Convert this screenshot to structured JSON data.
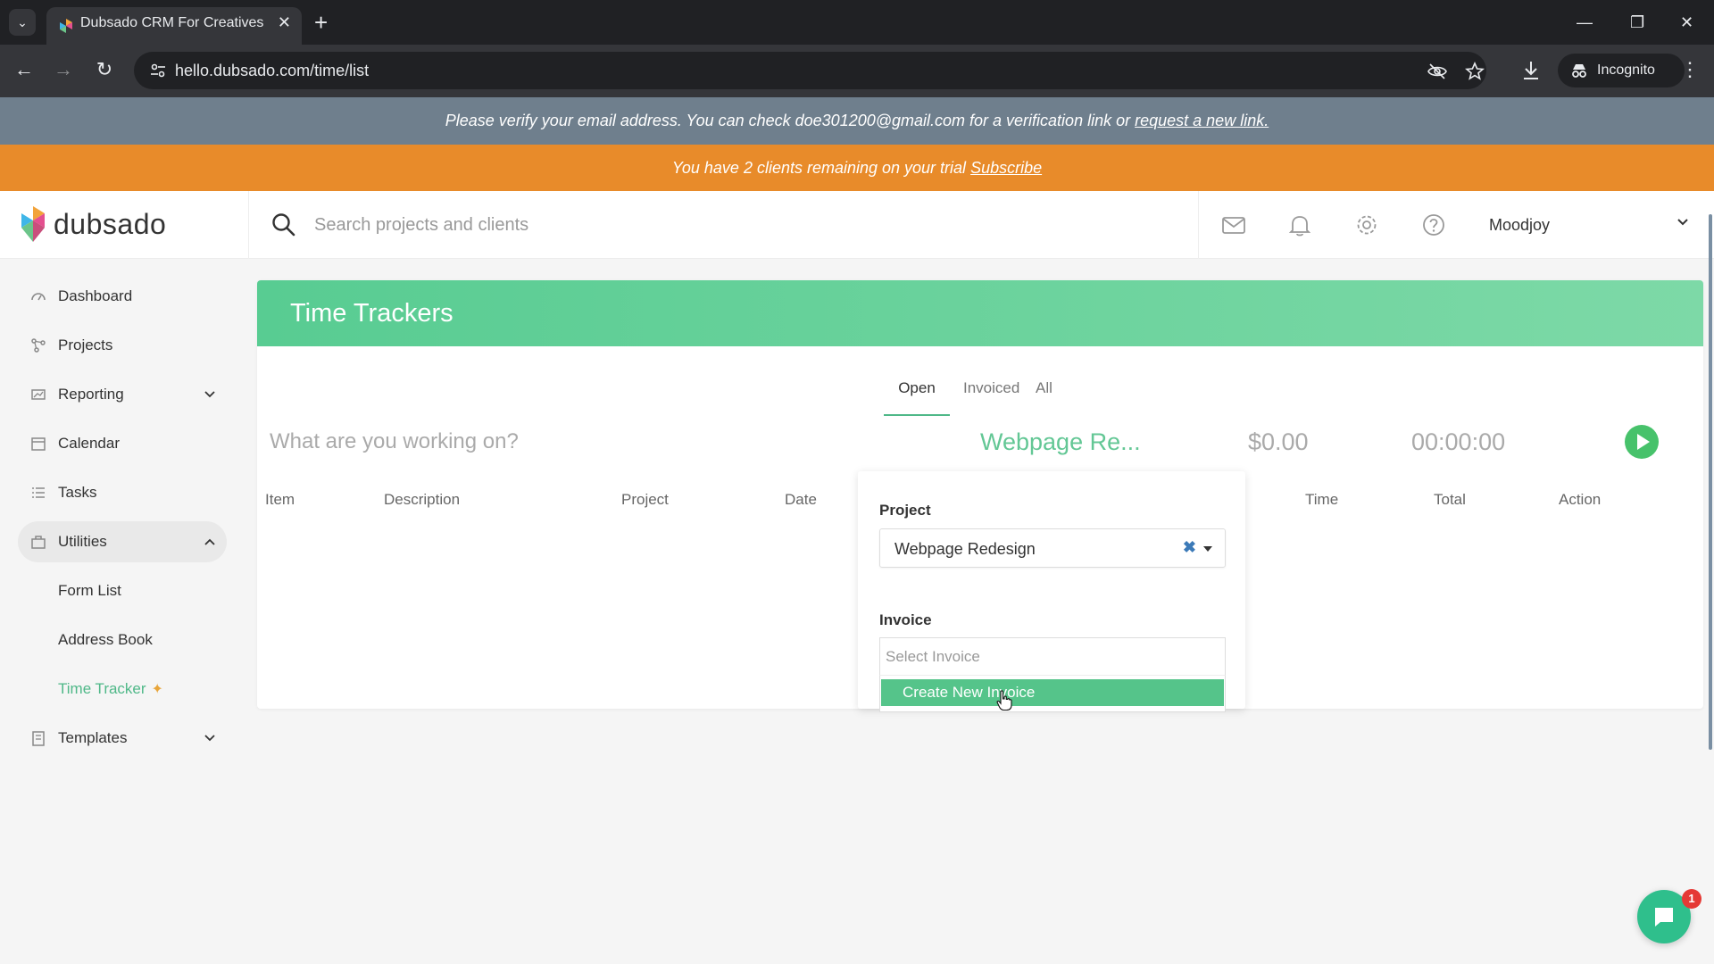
{
  "browser": {
    "tab_title": "Dubsado CRM For Creatives",
    "url": "hello.dubsado.com/time/list",
    "incognito_label": "Incognito"
  },
  "banners": {
    "verify_text": "Please verify your email address. You can check doe301200@gmail.com for a verification link or",
    "verify_link": "request a new link.",
    "trial_text": "You have 2 clients remaining on your trial",
    "trial_link": "Subscribe"
  },
  "header": {
    "logo_text": "dubsado",
    "search_placeholder": "Search projects and clients",
    "user_name": "Moodjoy"
  },
  "sidebar": {
    "items": [
      {
        "label": "Dashboard",
        "icon": "dashboard-icon"
      },
      {
        "label": "Projects",
        "icon": "projects-icon"
      },
      {
        "label": "Reporting",
        "icon": "reporting-icon"
      },
      {
        "label": "Calendar",
        "icon": "calendar-icon"
      },
      {
        "label": "Tasks",
        "icon": "tasks-icon"
      },
      {
        "label": "Utilities",
        "icon": "utilities-icon"
      },
      {
        "label": "Templates",
        "icon": "templates-icon"
      }
    ],
    "sub_items": [
      "Form List",
      "Address Book",
      "Time Tracker"
    ]
  },
  "main": {
    "title": "Time Trackers",
    "tabs": [
      "Open",
      "Invoiced",
      "All"
    ],
    "active_tab": "Open",
    "working_placeholder": "What are you working on?",
    "project_chip": "Webpage Re...",
    "amount": "$0.00",
    "timer": "00:00:00",
    "columns": [
      "Item",
      "Description",
      "Project",
      "Date",
      "Time",
      "Total",
      "Action"
    ]
  },
  "popover": {
    "project_label": "Project",
    "project_value": "Webpage Redesign",
    "invoice_label": "Invoice",
    "invoice_placeholder": "Select Invoice",
    "dropdown_item": "Create New Invoice"
  },
  "chat": {
    "badge_count": "1"
  },
  "colors": {
    "accent_green": "#4fb888",
    "trial_orange": "#e88b2a",
    "verify_gray": "#6f7f8d"
  }
}
